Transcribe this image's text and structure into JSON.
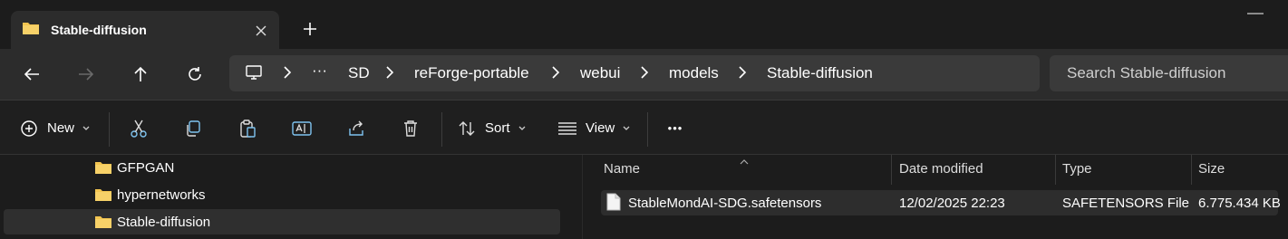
{
  "window": {
    "tab_title": "Stable-diffusion",
    "tab_icon": "folder-icon",
    "colors": {
      "folder": "#f2c450",
      "accent": "#60cdff"
    }
  },
  "nav": {
    "back": "back-arrow-icon",
    "forward": "forward-arrow-icon",
    "up": "up-arrow-icon",
    "refresh": "refresh-icon"
  },
  "address": {
    "overflow": "···",
    "segments": [
      "SD",
      "reForge-portable",
      "webui",
      "models",
      "Stable-diffusion"
    ]
  },
  "search": {
    "placeholder": "Search Stable-diffusion"
  },
  "toolbar": {
    "new_label": "New",
    "sort_label": "Sort",
    "view_label": "View",
    "more": "•••"
  },
  "tree": {
    "items": [
      {
        "label": "GFPGAN",
        "selected": false
      },
      {
        "label": "hypernetworks",
        "selected": false
      },
      {
        "label": "Stable-diffusion",
        "selected": true
      }
    ]
  },
  "list": {
    "columns": {
      "name": "Name",
      "date": "Date modified",
      "type": "Type",
      "size": "Size"
    },
    "files": [
      {
        "name": "StableMondAI-SDG.safetensors",
        "date": "12/02/2025 22:23",
        "type": "SAFETENSORS File",
        "size": "6.775.434 KB"
      }
    ]
  }
}
